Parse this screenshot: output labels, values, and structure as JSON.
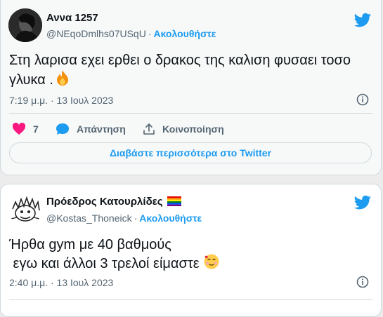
{
  "tweet1": {
    "name": "Αννα 1257",
    "handle": "@NEqoDmlhs07USqU",
    "separator": "·",
    "follow_label": "Ακολουθήστε",
    "text": "Στη λαρισα εχει ερθει ο δρακος της καλιση φυσαει τοσο",
    "text_line2": "γλυκα .",
    "timestamp": "7:19 μ.μ. · 13 Ιουλ 2023",
    "like_count": "7",
    "reply_label": "Απάντηση",
    "share_label": "Κοινοποίηση",
    "read_more_label": "Διαβάστε περισσότερα στο Twitter"
  },
  "tweet2": {
    "name": "Πρόεδρος Κατουρλίδες",
    "handle": "@Kostas_Thoneick",
    "separator": "·",
    "follow_label": "Ακολουθήστε",
    "text_line1": "Ήρθα gym με 40 βαθμούς",
    "text_line2": " εγω και άλλοι 3 τρελοί είμαστε",
    "timestamp": "2:40 μ.μ. · 13 Ιουλ 2023"
  },
  "colors": {
    "accent": "#1d9bf0",
    "like": "#f91880",
    "muted": "#536471",
    "border": "#cfd9de"
  },
  "icons": [
    "twitter-bird-icon",
    "info-icon",
    "heart-icon",
    "reply-bubble-icon",
    "share-icon",
    "fire-emoji",
    "smiling-face-hearts-emoji",
    "rainbow-flag-emoji"
  ]
}
